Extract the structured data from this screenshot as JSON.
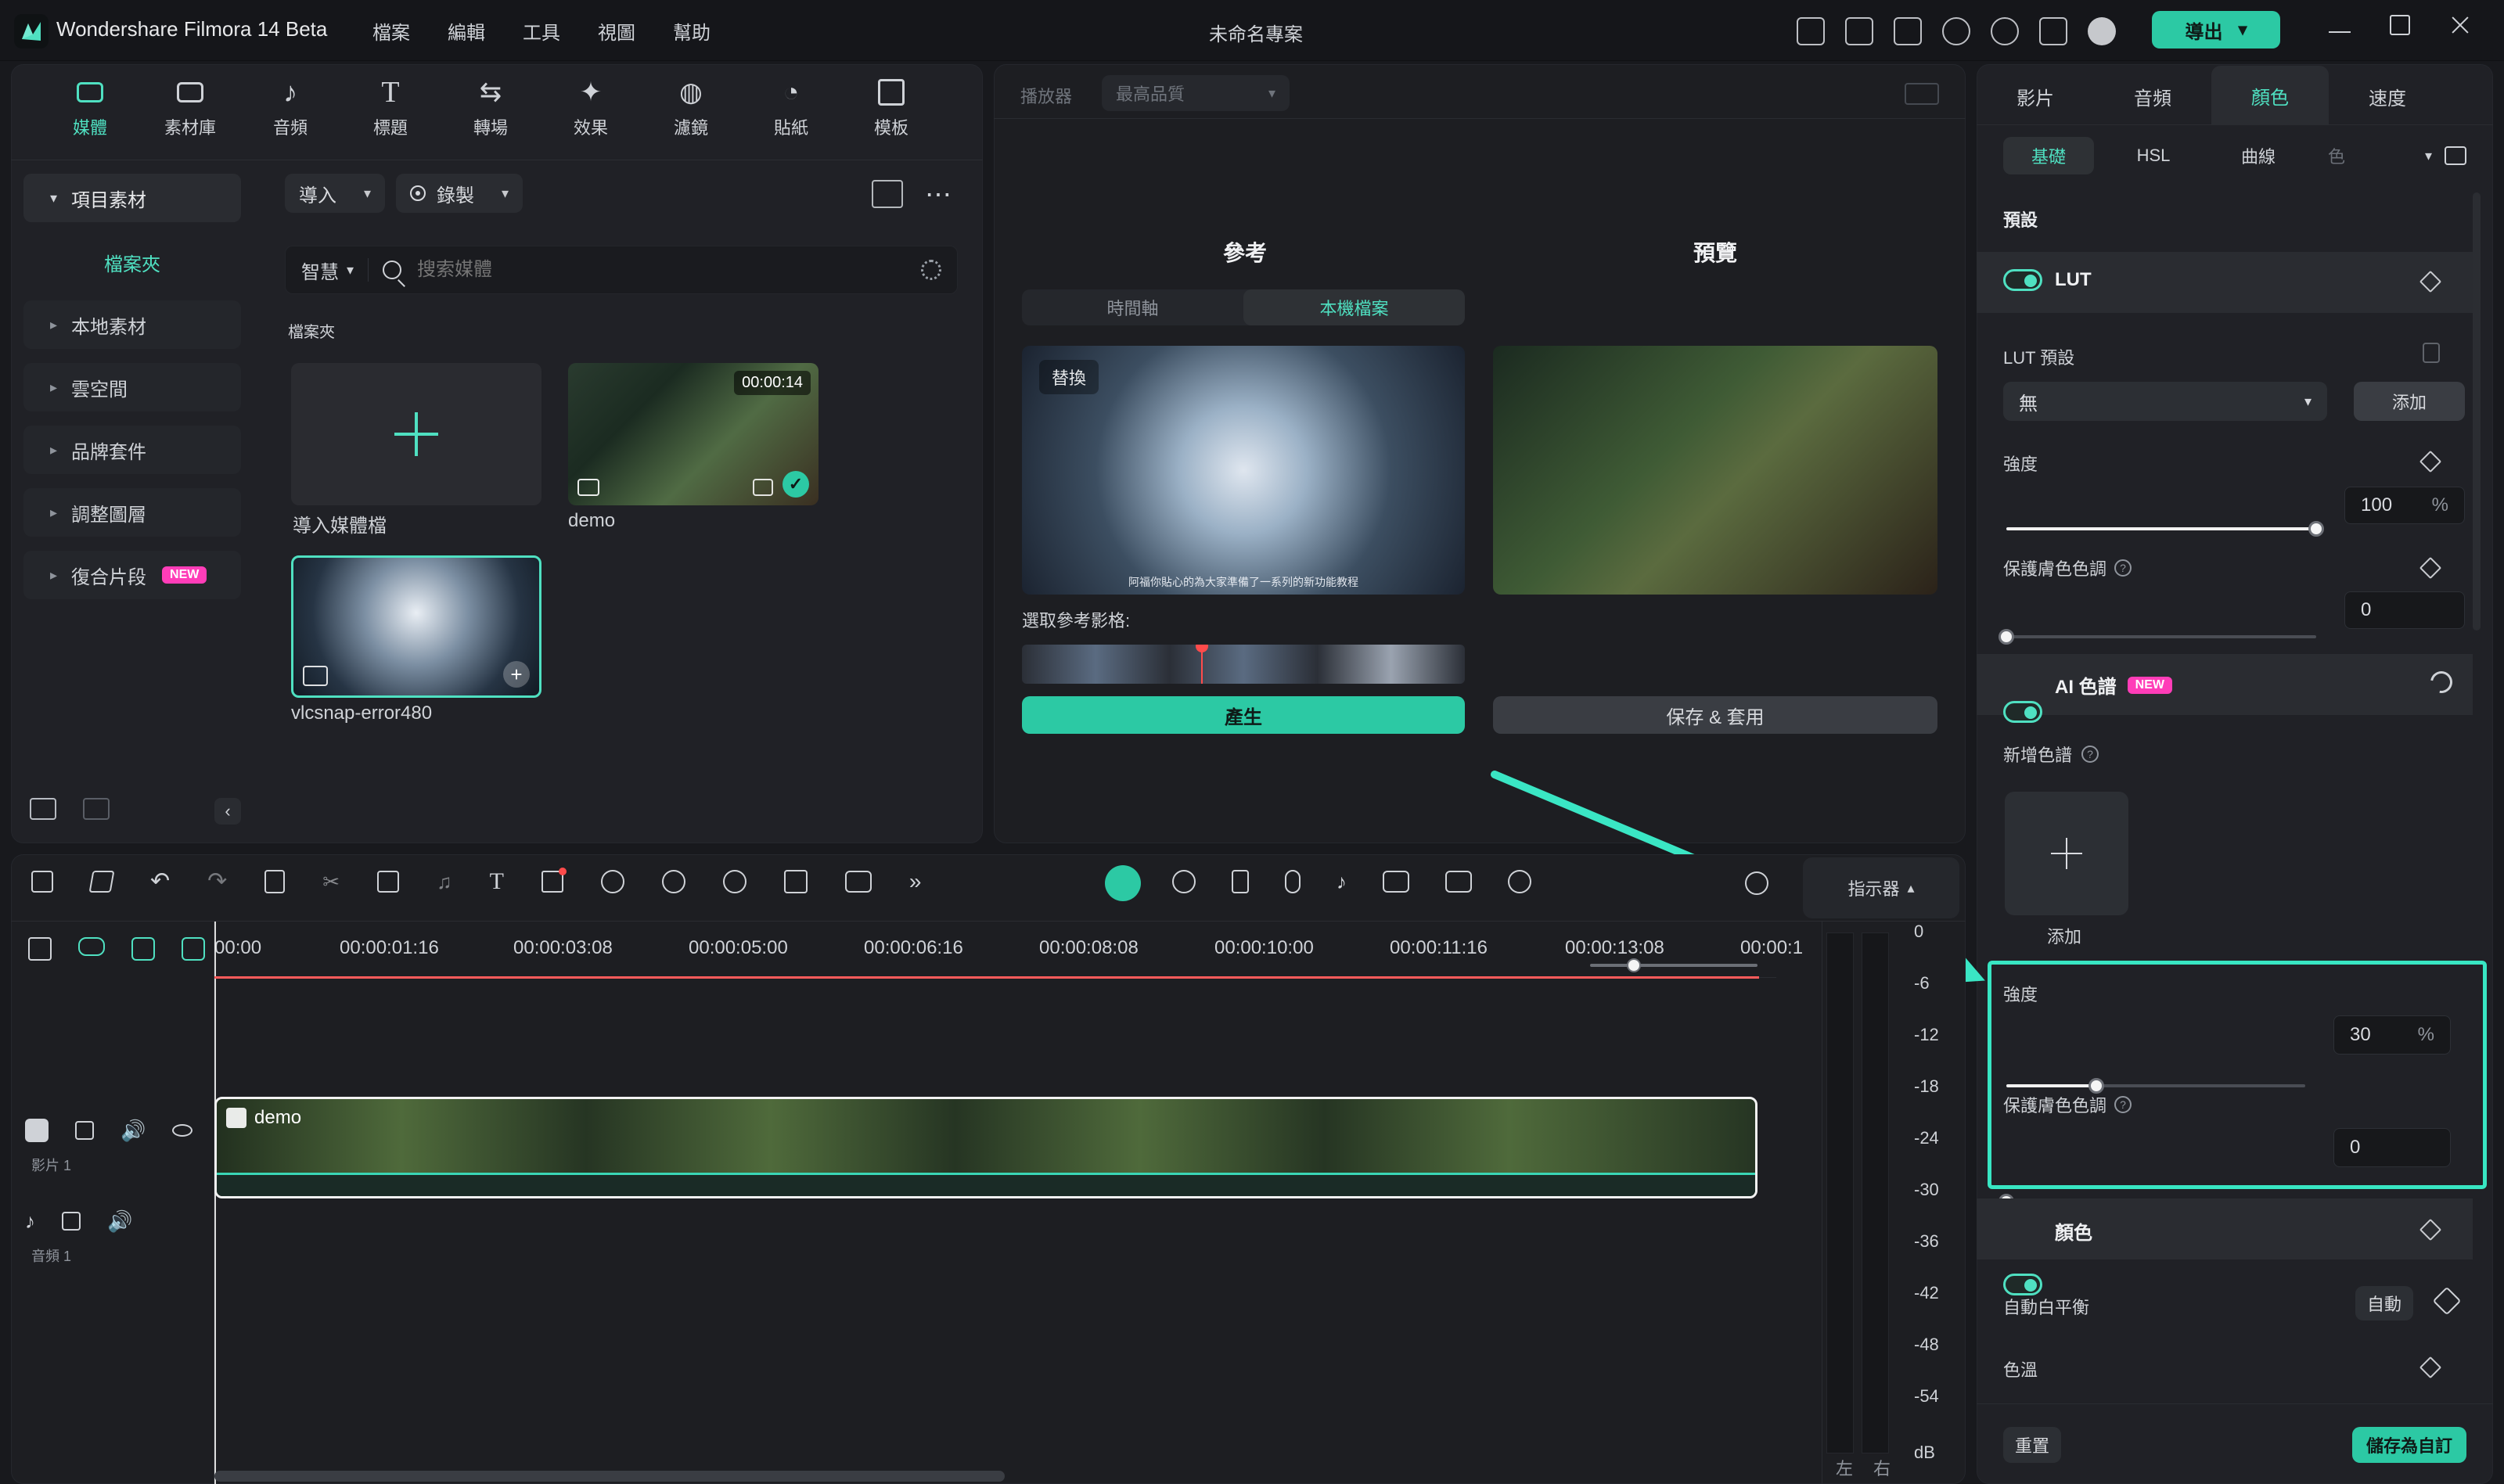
{
  "app": {
    "title": "Wondershare Filmora 14 Beta",
    "menu": [
      "檔案",
      "編輯",
      "工具",
      "視圖",
      "幫助"
    ],
    "project_title": "未命名專案",
    "export_label": "導出"
  },
  "topnav": {
    "items": [
      {
        "label": "媒體",
        "icon": "media-icon"
      },
      {
        "label": "素材庫",
        "icon": "library-icon"
      },
      {
        "label": "音頻",
        "icon": "music-icon"
      },
      {
        "label": "標題",
        "icon": "title-icon"
      },
      {
        "label": "轉場",
        "icon": "transition-icon"
      },
      {
        "label": "效果",
        "icon": "effects-icon"
      },
      {
        "label": "濾鏡",
        "icon": "filter-icon"
      },
      {
        "label": "貼紙",
        "icon": "sticker-icon"
      },
      {
        "label": "模板",
        "icon": "template-icon"
      }
    ]
  },
  "left_tree": {
    "project_assets": "項目素材",
    "folder": "檔案夾",
    "items": [
      "本地素材",
      "雲空間",
      "品牌套件",
      "調整圖層",
      "復合片段"
    ],
    "new_badge": "NEW"
  },
  "media_toolbar": {
    "import": "導入",
    "record": "錄製",
    "smart": "智慧",
    "search_placeholder": "搜索媒體",
    "folder_label": "檔案夾"
  },
  "media_items": [
    {
      "name": "導入媒體檔",
      "type": "import"
    },
    {
      "name": "demo",
      "duration": "00:00:14",
      "type": "video"
    },
    {
      "name": "vlcsnap-error480",
      "type": "image"
    }
  ],
  "player": {
    "label": "播放器",
    "quality": "最高品質",
    "reference_title": "參考",
    "preview_title": "預覽",
    "tabs": [
      "時間軸",
      "本機檔案"
    ],
    "replace": "替換",
    "caption": "阿福你貼心的為大家準備了一系列的新功能教程",
    "choose_ref": "選取參考影格:",
    "generate": "產生",
    "save_apply": "保存 & 套用"
  },
  "right_panel": {
    "tabs": [
      "影片",
      "音頻",
      "顏色",
      "速度"
    ],
    "subtabs": [
      "基礎",
      "HSL",
      "曲線",
      "色"
    ],
    "preset_title": "預設",
    "lut_label": "LUT",
    "lut_preset": "LUT 預設",
    "lut_value": "無",
    "add": "添加",
    "strength": "強度",
    "strength_value": "100",
    "percent": "%",
    "skin_protect": "保護膚色色調",
    "skin_value": "0",
    "ai_palette": "AI 色譜",
    "new": "NEW",
    "add_palette": "新增色譜",
    "add_small": "添加",
    "strength2_value": "30",
    "skin2_value": "0",
    "color_section": "顏色",
    "auto_white_balance": "自動白平衡",
    "auto": "自動",
    "tint": "色溫",
    "reset": "重置",
    "save_custom": "儲存為自訂"
  },
  "timeline": {
    "indicator": "指示器",
    "times": [
      "00:00",
      "00:00:01:16",
      "00:00:03:08",
      "00:00:05:00",
      "00:00:06:16",
      "00:00:08:08",
      "00:00:10:00",
      "00:00:11:16",
      "00:00:13:08",
      "00:00:1"
    ],
    "track_video_label": "影片 1",
    "track_audio_label": "音頻 1",
    "clip_name": "demo",
    "db_scale": [
      "0",
      "-6",
      "-12",
      "-18",
      "-24",
      "-30",
      "-36",
      "-42",
      "-48",
      "-54"
    ],
    "db_unit": "dB",
    "lr": [
      "左",
      "右"
    ]
  }
}
